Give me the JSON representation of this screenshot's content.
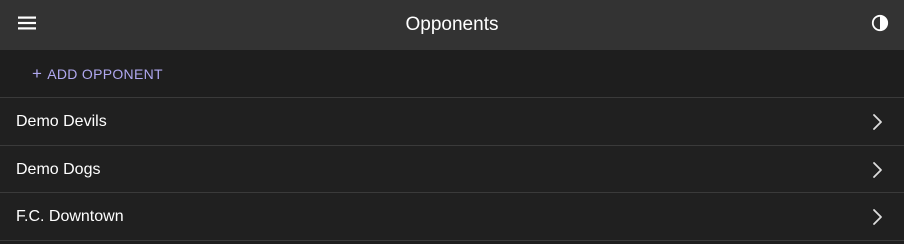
{
  "header": {
    "title": "Opponents",
    "menu_icon": "menu-icon",
    "theme_icon": "contrast-icon"
  },
  "actions": {
    "add_label": "ADD OPPONENT",
    "add_icon": "plus-icon"
  },
  "opponents": [
    {
      "name": "Demo Devils"
    },
    {
      "name": "Demo Dogs"
    },
    {
      "name": "F.C. Downtown"
    }
  ],
  "colors": {
    "toolbar_bg": "#333333",
    "page_bg": "#1e1e1e",
    "accent": "#b0a8f0",
    "divider": "#3a3a3a",
    "text": "#ffffff"
  }
}
